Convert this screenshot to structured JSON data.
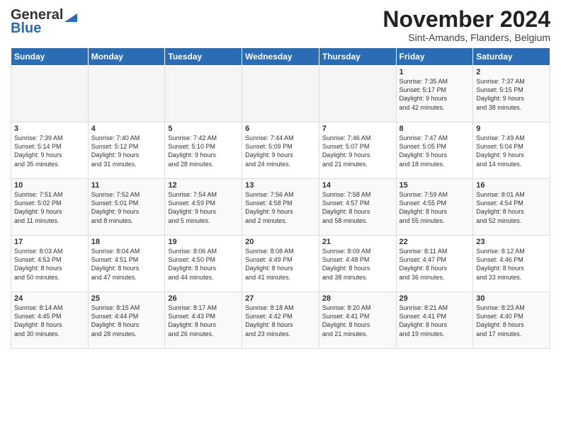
{
  "logo": {
    "line1": "General",
    "line2": "Blue"
  },
  "title": "November 2024",
  "subtitle": "Sint-Amands, Flanders, Belgium",
  "days_header": [
    "Sunday",
    "Monday",
    "Tuesday",
    "Wednesday",
    "Thursday",
    "Friday",
    "Saturday"
  ],
  "weeks": [
    [
      {
        "day": "",
        "detail": ""
      },
      {
        "day": "",
        "detail": ""
      },
      {
        "day": "",
        "detail": ""
      },
      {
        "day": "",
        "detail": ""
      },
      {
        "day": "",
        "detail": ""
      },
      {
        "day": "1",
        "detail": "Sunrise: 7:35 AM\nSunset: 5:17 PM\nDaylight: 9 hours\nand 42 minutes."
      },
      {
        "day": "2",
        "detail": "Sunrise: 7:37 AM\nSunset: 5:15 PM\nDaylight: 9 hours\nand 38 minutes."
      }
    ],
    [
      {
        "day": "3",
        "detail": "Sunrise: 7:39 AM\nSunset: 5:14 PM\nDaylight: 9 hours\nand 35 minutes."
      },
      {
        "day": "4",
        "detail": "Sunrise: 7:40 AM\nSunset: 5:12 PM\nDaylight: 9 hours\nand 31 minutes."
      },
      {
        "day": "5",
        "detail": "Sunrise: 7:42 AM\nSunset: 5:10 PM\nDaylight: 9 hours\nand 28 minutes."
      },
      {
        "day": "6",
        "detail": "Sunrise: 7:44 AM\nSunset: 5:09 PM\nDaylight: 9 hours\nand 24 minutes."
      },
      {
        "day": "7",
        "detail": "Sunrise: 7:46 AM\nSunset: 5:07 PM\nDaylight: 9 hours\nand 21 minutes."
      },
      {
        "day": "8",
        "detail": "Sunrise: 7:47 AM\nSunset: 5:05 PM\nDaylight: 9 hours\nand 18 minutes."
      },
      {
        "day": "9",
        "detail": "Sunrise: 7:49 AM\nSunset: 5:04 PM\nDaylight: 9 hours\nand 14 minutes."
      }
    ],
    [
      {
        "day": "10",
        "detail": "Sunrise: 7:51 AM\nSunset: 5:02 PM\nDaylight: 9 hours\nand 11 minutes."
      },
      {
        "day": "11",
        "detail": "Sunrise: 7:52 AM\nSunset: 5:01 PM\nDaylight: 9 hours\nand 8 minutes."
      },
      {
        "day": "12",
        "detail": "Sunrise: 7:54 AM\nSunset: 4:59 PM\nDaylight: 9 hours\nand 5 minutes."
      },
      {
        "day": "13",
        "detail": "Sunrise: 7:56 AM\nSunset: 4:58 PM\nDaylight: 9 hours\nand 2 minutes."
      },
      {
        "day": "14",
        "detail": "Sunrise: 7:58 AM\nSunset: 4:57 PM\nDaylight: 8 hours\nand 58 minutes."
      },
      {
        "day": "15",
        "detail": "Sunrise: 7:59 AM\nSunset: 4:55 PM\nDaylight: 8 hours\nand 55 minutes."
      },
      {
        "day": "16",
        "detail": "Sunrise: 8:01 AM\nSunset: 4:54 PM\nDaylight: 8 hours\nand 52 minutes."
      }
    ],
    [
      {
        "day": "17",
        "detail": "Sunrise: 8:03 AM\nSunset: 4:53 PM\nDaylight: 8 hours\nand 50 minutes."
      },
      {
        "day": "18",
        "detail": "Sunrise: 8:04 AM\nSunset: 4:51 PM\nDaylight: 8 hours\nand 47 minutes."
      },
      {
        "day": "19",
        "detail": "Sunrise: 8:06 AM\nSunset: 4:50 PM\nDaylight: 8 hours\nand 44 minutes."
      },
      {
        "day": "20",
        "detail": "Sunrise: 8:08 AM\nSunset: 4:49 PM\nDaylight: 8 hours\nand 41 minutes."
      },
      {
        "day": "21",
        "detail": "Sunrise: 8:09 AM\nSunset: 4:48 PM\nDaylight: 8 hours\nand 38 minutes."
      },
      {
        "day": "22",
        "detail": "Sunrise: 8:11 AM\nSunset: 4:47 PM\nDaylight: 8 hours\nand 36 minutes."
      },
      {
        "day": "23",
        "detail": "Sunrise: 8:12 AM\nSunset: 4:46 PM\nDaylight: 8 hours\nand 33 minutes."
      }
    ],
    [
      {
        "day": "24",
        "detail": "Sunrise: 8:14 AM\nSunset: 4:45 PM\nDaylight: 8 hours\nand 30 minutes."
      },
      {
        "day": "25",
        "detail": "Sunrise: 8:15 AM\nSunset: 4:44 PM\nDaylight: 8 hours\nand 28 minutes."
      },
      {
        "day": "26",
        "detail": "Sunrise: 8:17 AM\nSunset: 4:43 PM\nDaylight: 8 hours\nand 26 minutes."
      },
      {
        "day": "27",
        "detail": "Sunrise: 8:18 AM\nSunset: 4:42 PM\nDaylight: 8 hours\nand 23 minutes."
      },
      {
        "day": "28",
        "detail": "Sunrise: 8:20 AM\nSunset: 4:41 PM\nDaylight: 8 hours\nand 21 minutes."
      },
      {
        "day": "29",
        "detail": "Sunrise: 8:21 AM\nSunset: 4:41 PM\nDaylight: 8 hours\nand 19 minutes."
      },
      {
        "day": "30",
        "detail": "Sunrise: 8:23 AM\nSunset: 4:40 PM\nDaylight: 8 hours\nand 17 minutes."
      }
    ]
  ]
}
